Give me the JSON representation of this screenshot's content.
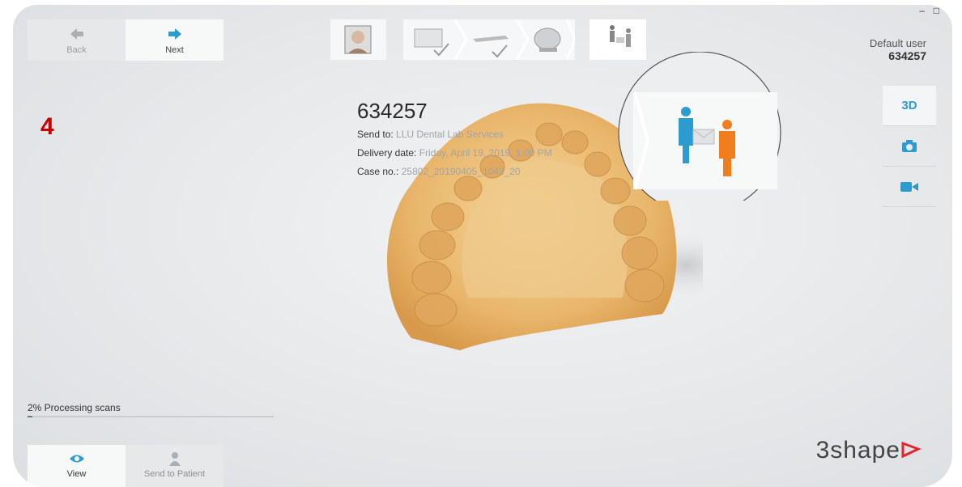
{
  "nav": {
    "back_label": "Back",
    "next_label": "Next"
  },
  "window_controls": {
    "minimize": "–",
    "maximize": "□"
  },
  "user": {
    "name": "Default user",
    "id": "634257"
  },
  "side_tabs": {
    "view3d": "3D"
  },
  "step_number": "4",
  "case": {
    "id": "634257",
    "send_to_label": "Send to:",
    "send_to_value": "LLU Dental Lab Services",
    "delivery_label": "Delivery date:",
    "delivery_value": "Friday, April 19, 2019, 1:00 PM",
    "caseno_label": "Case no.:",
    "caseno_value": "25802_20190405_1043_20"
  },
  "progress": {
    "text": "2% Processing scans",
    "fraction": 0.02
  },
  "bottom_tabs": {
    "view_label": "View",
    "send_label": "Send to Patient"
  },
  "brand": {
    "logo": "3shape"
  },
  "colors": {
    "accent": "#2c9bd0",
    "orange": "#f07d1e",
    "brand_red": "#e3262e"
  }
}
